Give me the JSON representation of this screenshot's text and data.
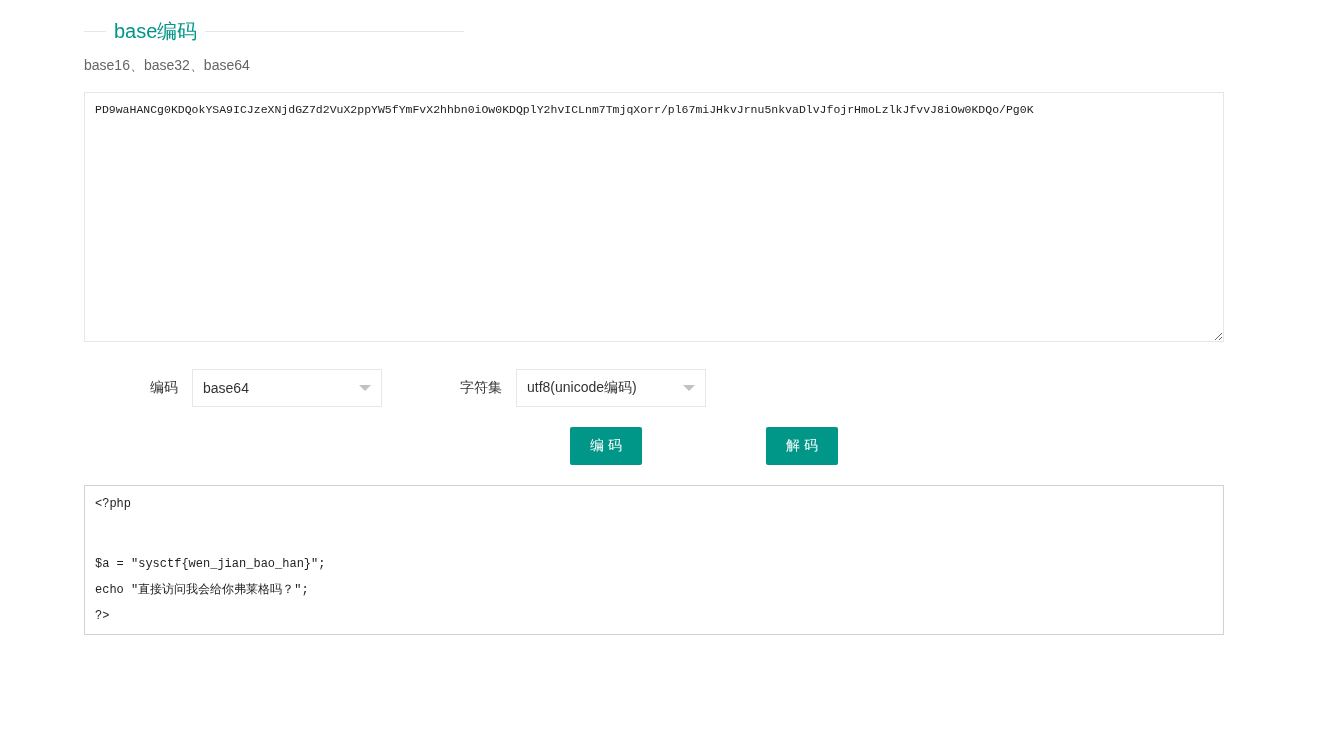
{
  "section": {
    "title": "base编码",
    "subtitle": "base16、base32、base64"
  },
  "input": {
    "value": "PD9waHANCg0KDQokYSA9ICJzeXNjdGZ7d2VuX2ppYW5fYmFvX2hhbn0iOw0KDQplY2hvICLnm7TmjqXorr/pl67miJHkvJrnu5nkvaDlvJfojrHmoLzlkJfvvJ8iOw0KDQo/Pg0K"
  },
  "options": [
    {
      "label": "编码",
      "value": "base64"
    },
    {
      "label": "字符集",
      "value": "utf8(unicode编码)"
    }
  ],
  "buttons": [
    "编 码",
    "解 码"
  ],
  "output": {
    "lines": [
      "<?php",
      "$a = \"sysctf{wen_jian_bao_han}\";",
      "echo \"直接访问我会给你弗莱格吗？\";",
      "?>"
    ]
  }
}
